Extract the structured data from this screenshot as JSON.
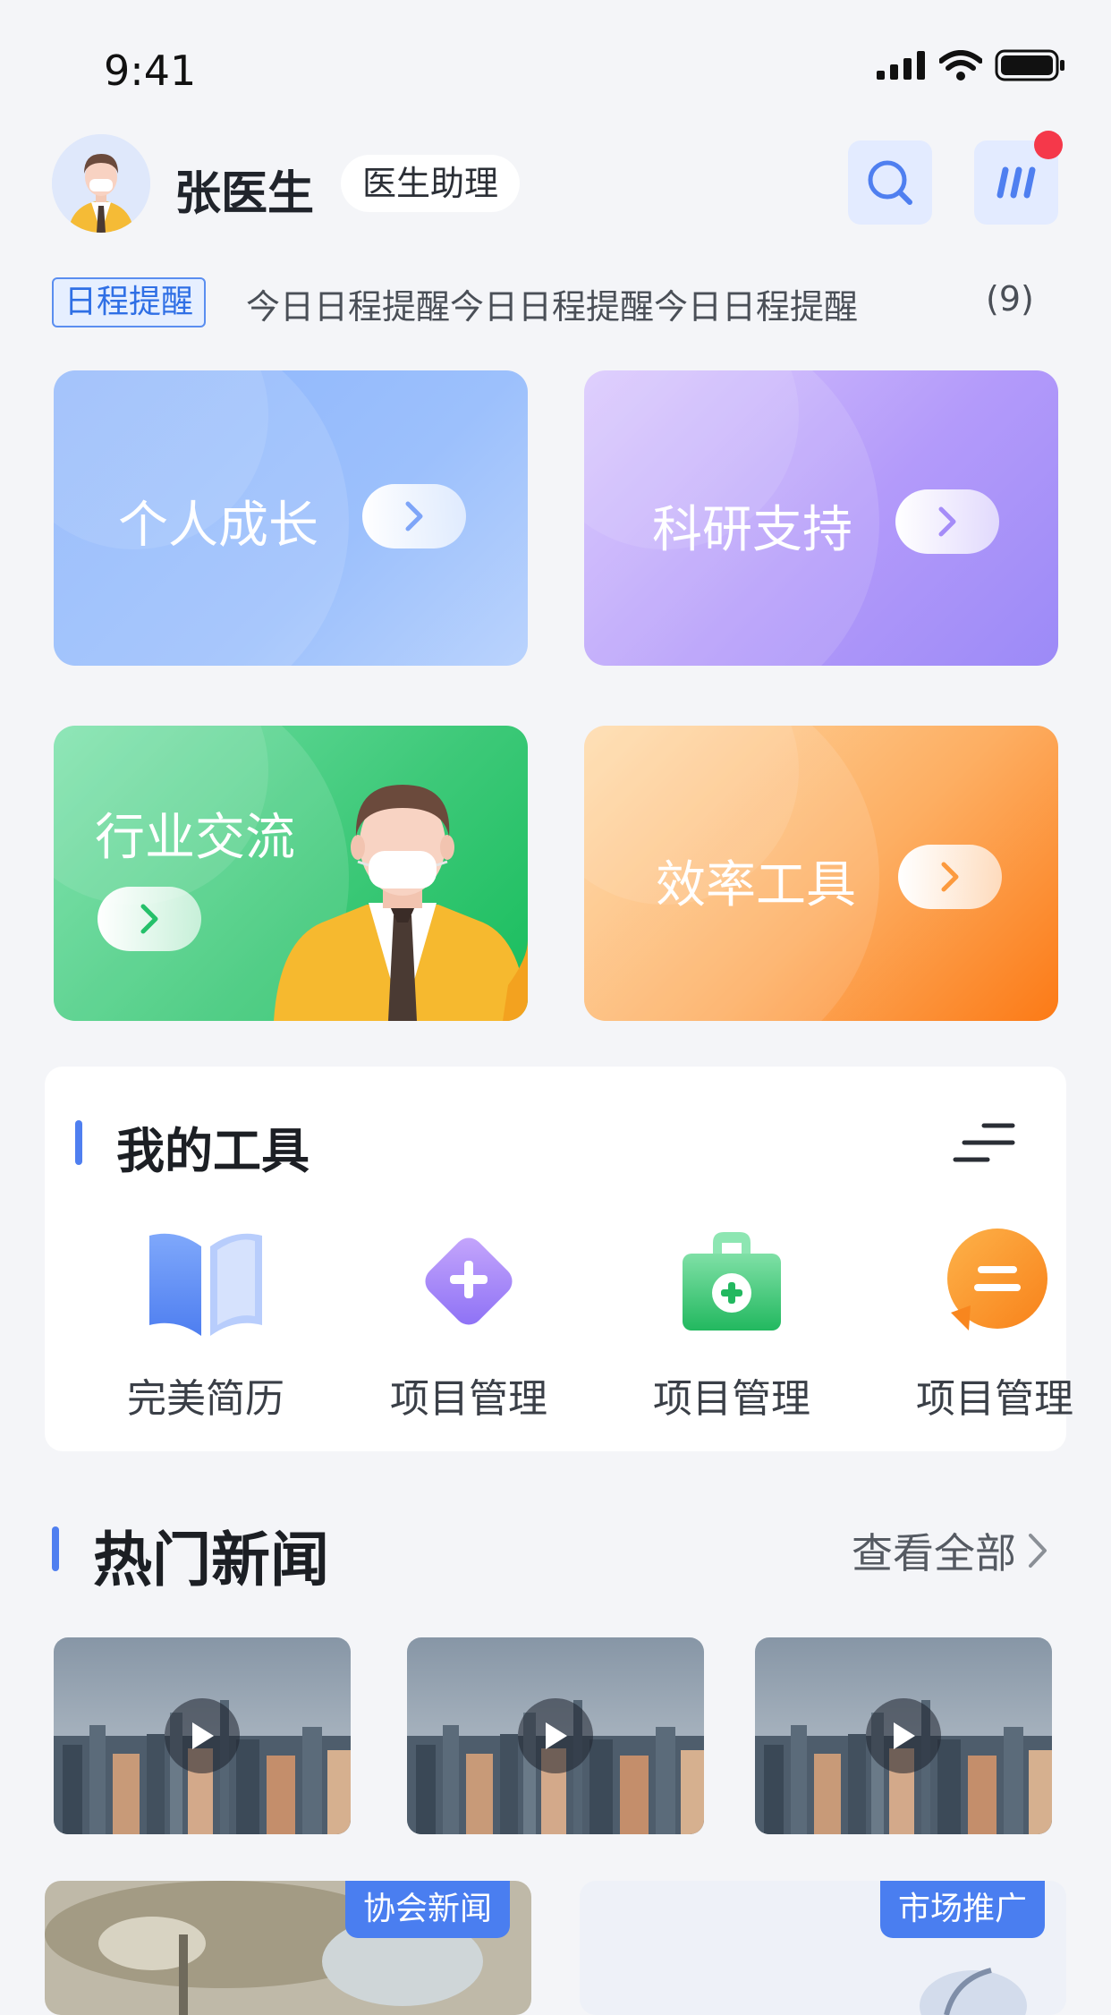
{
  "status_bar": {
    "time": "9:41"
  },
  "header": {
    "name": "张医生",
    "role": "医生助理"
  },
  "schedule": {
    "tag": "日程提醒",
    "text": "今日日程提醒今日日程提醒今日日程提醒",
    "count": "(9)"
  },
  "cards": {
    "growth": "个人成长",
    "research": "科研支持",
    "industry": "行业交流",
    "efficiency": "效率工具"
  },
  "tools": {
    "title": "我的工具",
    "items": [
      {
        "label": "完美简历",
        "icon": "open-book-icon"
      },
      {
        "label": "项目管理",
        "icon": "diamond-plus-icon"
      },
      {
        "label": "项目管理",
        "icon": "medical-kit-icon"
      },
      {
        "label": "项目管理",
        "icon": "chat-bubble-icon"
      }
    ]
  },
  "news": {
    "title": "热门新闻",
    "view_all": "查看全部",
    "stories": [
      {
        "badge": "协会新闻"
      },
      {
        "badge": "市场推广"
      }
    ]
  },
  "colors": {
    "accent": "#4f7ff0",
    "notification": "#f5384a",
    "badge": "#4a7ef0"
  }
}
